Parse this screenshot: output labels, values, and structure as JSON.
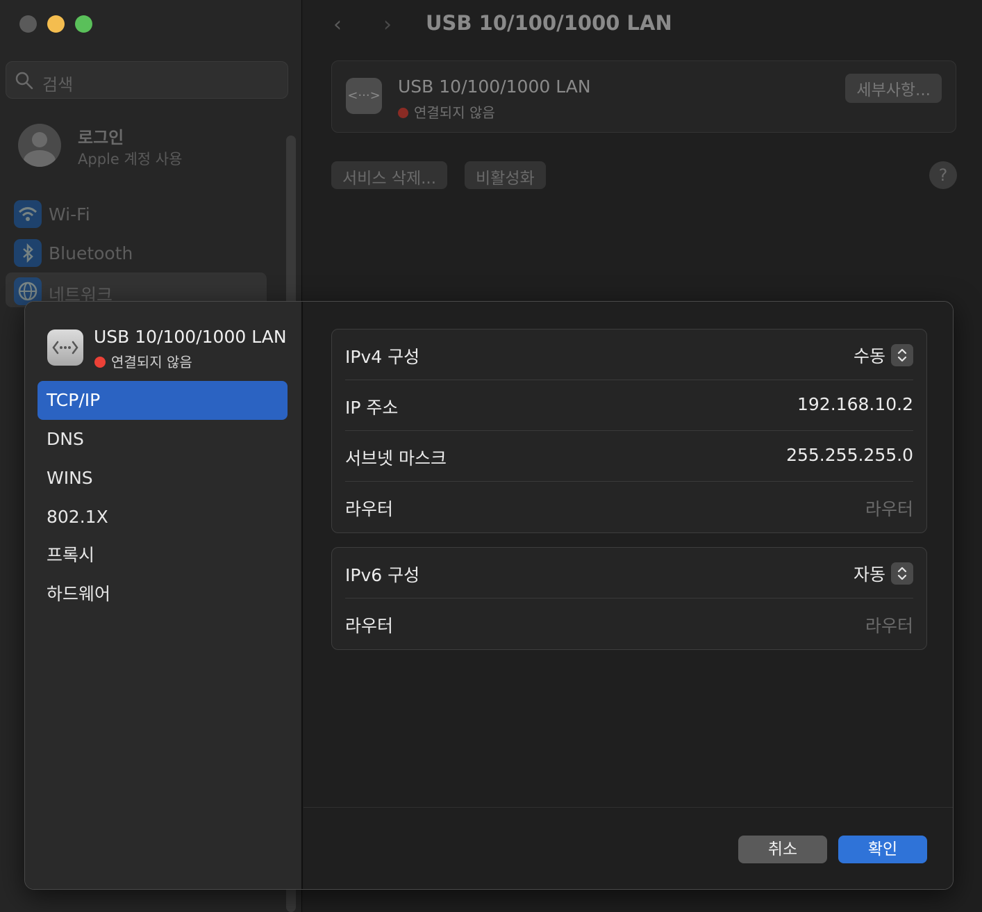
{
  "background": {
    "search_placeholder": "검색",
    "account": {
      "title": "로그인",
      "subtitle": "Apple 계정 사용"
    },
    "sidebar_items": [
      {
        "label": "Wi-Fi",
        "icon": "wifi-icon"
      },
      {
        "label": "Bluetooth",
        "icon": "bluetooth-icon"
      },
      {
        "label": "네트워크",
        "icon": "globe-icon"
      }
    ],
    "window_title": "USB 10/100/1000 LAN",
    "service_card": {
      "title": "USB 10/100/1000 LAN",
      "status": "연결되지 않음",
      "details_button": "세부사항..."
    },
    "delete_service_button": "서비스 삭제...",
    "deactivate_button": "비활성화",
    "help_button": "?"
  },
  "sheet": {
    "interface": {
      "title": "USB 10/100/1000 LAN",
      "status": "연결되지 않음",
      "status_color": "#ec4137"
    },
    "nav": [
      {
        "label": "TCP/IP",
        "active": true
      },
      {
        "label": "DNS",
        "active": false
      },
      {
        "label": "WINS",
        "active": false
      },
      {
        "label": "802.1X",
        "active": false
      },
      {
        "label": "프록시",
        "active": false
      },
      {
        "label": "하드웨어",
        "active": false
      }
    ],
    "ipv4": {
      "config_label": "IPv4 구성",
      "config_value": "수동",
      "ip_label": "IP 주소",
      "ip_value": "192.168.10.2",
      "subnet_label": "서브넷 마스크",
      "subnet_value": "255.255.255.0",
      "router_label": "라우터",
      "router_placeholder": "라우터"
    },
    "ipv6": {
      "config_label": "IPv6 구성",
      "config_value": "자동",
      "router_label": "라우터",
      "router_placeholder": "라우터"
    },
    "cancel_button": "취소",
    "ok_button": "확인",
    "accent_color": "#2b63c2"
  }
}
